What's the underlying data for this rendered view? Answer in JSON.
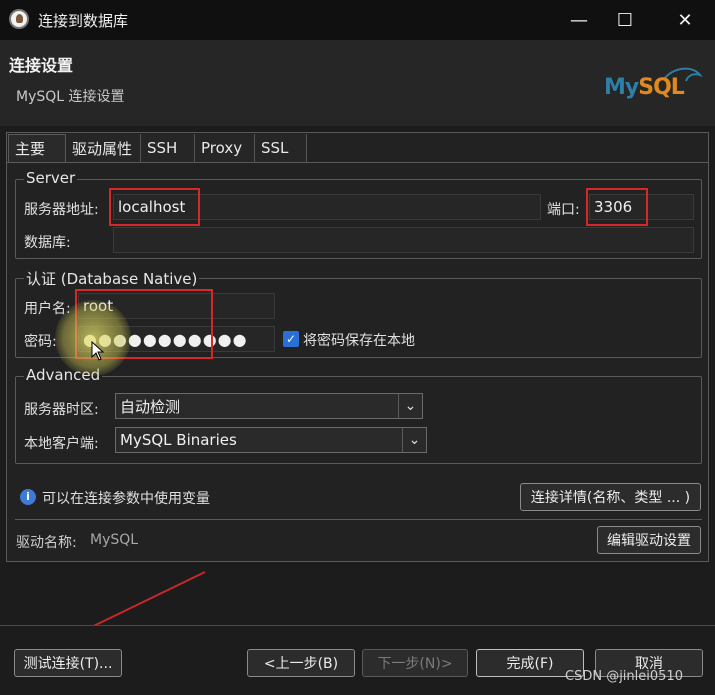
{
  "window": {
    "title": "连接到数据库",
    "minimize": "—",
    "maximize": "☐",
    "close": "✕"
  },
  "header": {
    "title": "连接设置",
    "subtitle": "MySQL 连接设置",
    "logo_my": "My",
    "logo_sql": "SQL"
  },
  "tabs": [
    "主要",
    "驱动属性",
    "SSH",
    "Proxy",
    "SSL"
  ],
  "server": {
    "legend": "Server",
    "host_label": "服务器地址:",
    "host_value": "localhost",
    "port_label": "端口:",
    "port_value": "3306",
    "database_label": "数据库:",
    "database_value": ""
  },
  "auth": {
    "legend": "认证 (Database Native)",
    "user_label": "用户名:",
    "user_value": "root",
    "password_label": "密码:",
    "password_value": "●●●●●●●●●●●",
    "save_password_label": "将密码保存在本地",
    "save_password_checked": true
  },
  "advanced": {
    "legend": "Advanced",
    "timezone_label": "服务器时区:",
    "timezone_value": "自动检测",
    "client_label": "本地客户端:",
    "client_value": "MySQL Binaries"
  },
  "variables_hint": "可以在连接参数中使用变量",
  "connection_details_button": "连接详情(名称、类型 ... )",
  "driver": {
    "label": "驱动名称:",
    "value": "MySQL",
    "edit_button": "编辑驱动设置"
  },
  "footer": {
    "test_button": "测试连接(T)...",
    "back_button": "<上一步(B)",
    "next_button": "下一步(N)>",
    "finish_button": "完成(F)",
    "cancel_button": "取消"
  },
  "watermark": "CSDN @jinlei0510",
  "colors": {
    "highlight_box": "#d6282a",
    "checkbox": "#2a6fd6",
    "mysql_blue": "#2e7ea6",
    "mysql_orange": "#e08a1e"
  }
}
